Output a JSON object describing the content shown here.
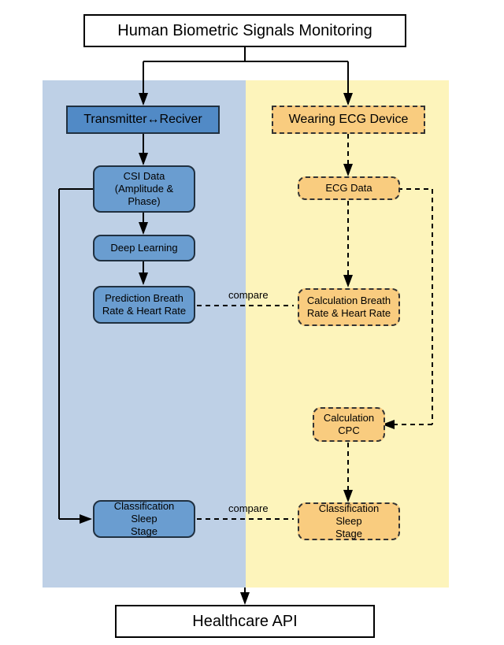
{
  "title": "Human Biometric Signals Monitoring",
  "footer": "Healthcare API",
  "left": {
    "header": "Transmitter↔Reciver",
    "csi": "CSI Data\n(Amplitude &\nPhase)",
    "dl": "Deep Learning",
    "pred": "Prediction Breath\nRate & Heart Rate",
    "cls": "Classification Sleep\nStage"
  },
  "right": {
    "header": "Wearing ECG Device",
    "ecg": "ECG Data",
    "calc": "Calculation Breath\nRate & Heart Rate",
    "cpc": "Calculation\nCPC",
    "cls": "Classification Sleep\nStage"
  },
  "labels": {
    "compare1": "compare",
    "compare2": "compare"
  },
  "colors": {
    "panel_left": "#bed0e6",
    "panel_right": "#fdf4bb",
    "node_left": "#6a9dd0",
    "node_right": "#f9cc7f"
  },
  "chart_data": {
    "type": "diagram",
    "title": "Human Biometric Signals Monitoring",
    "nodes": [
      {
        "id": "root",
        "label": "Human Biometric Signals Monitoring",
        "style": "plain"
      },
      {
        "id": "txrx",
        "label": "Transmitter↔Reciver",
        "style": "blue-header"
      },
      {
        "id": "csi",
        "label": "CSI Data (Amplitude & Phase)",
        "style": "blue"
      },
      {
        "id": "dl",
        "label": "Deep Learning",
        "style": "blue"
      },
      {
        "id": "pred",
        "label": "Prediction Breath Rate & Heart Rate",
        "style": "blue"
      },
      {
        "id": "cls_l",
        "label": "Classification Sleep Stage",
        "style": "blue"
      },
      {
        "id": "ecghdr",
        "label": "Wearing ECG Device",
        "style": "yellow-header"
      },
      {
        "id": "ecg",
        "label": "ECG Data",
        "style": "yellow"
      },
      {
        "id": "calc",
        "label": "Calculation Breath Rate & Heart Rate",
        "style": "yellow"
      },
      {
        "id": "cpc",
        "label": "Calculation CPC",
        "style": "yellow"
      },
      {
        "id": "cls_r",
        "label": "Classification Sleep Stage",
        "style": "yellow"
      },
      {
        "id": "api",
        "label": "Healthcare API",
        "style": "plain"
      }
    ],
    "edges": [
      {
        "from": "root",
        "to": "txrx",
        "style": "solid"
      },
      {
        "from": "root",
        "to": "ecghdr",
        "style": "solid"
      },
      {
        "from": "txrx",
        "to": "csi",
        "style": "solid"
      },
      {
        "from": "csi",
        "to": "dl",
        "style": "solid"
      },
      {
        "from": "dl",
        "to": "pred",
        "style": "solid"
      },
      {
        "from": "csi",
        "to": "cls_l",
        "style": "solid",
        "note": "via left side path"
      },
      {
        "from": "ecghdr",
        "to": "ecg",
        "style": "dashed"
      },
      {
        "from": "ecg",
        "to": "calc",
        "style": "dashed"
      },
      {
        "from": "ecg",
        "to": "cpc",
        "style": "dashed",
        "note": "via right side path"
      },
      {
        "from": "cpc",
        "to": "cls_r",
        "style": "dashed"
      },
      {
        "from": "pred",
        "to": "calc",
        "style": "dashed",
        "label": "compare"
      },
      {
        "from": "cls_l",
        "to": "cls_r",
        "style": "dashed",
        "label": "compare"
      },
      {
        "from": "cls_l",
        "to": "api",
        "style": "solid",
        "note": "merged"
      },
      {
        "from": "cls_r",
        "to": "api",
        "style": "solid",
        "note": "merged"
      }
    ]
  }
}
